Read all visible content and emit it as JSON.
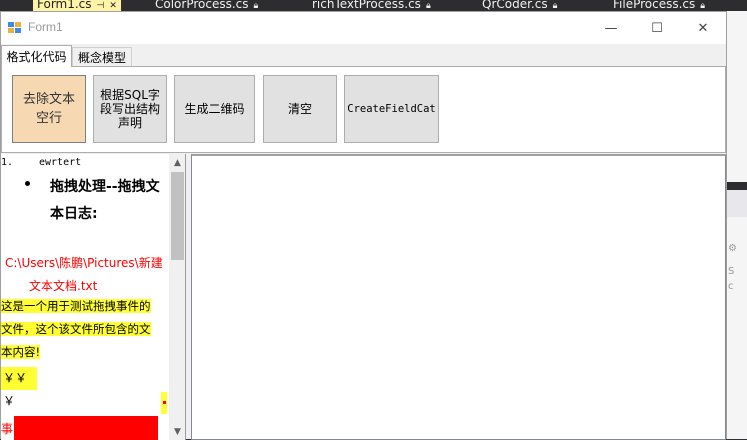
{
  "ide": {
    "tabs": [
      {
        "label": "Form1.cs",
        "active": true
      },
      {
        "label": "ColorProcess.cs",
        "active": false
      },
      {
        "label": "richTextProcess.cs",
        "active": false
      },
      {
        "label": "QrCoder.cs",
        "active": false
      },
      {
        "label": "FileProcess.cs",
        "active": false
      }
    ],
    "right_symbols": [
      "S",
      "c"
    ]
  },
  "window": {
    "title": "Form1",
    "icon": "winforms-app-icon",
    "controls": [
      "minimize-icon",
      "maximize-icon",
      "close-icon"
    ],
    "control_glyphs": [
      "—",
      "☐",
      "✕"
    ]
  },
  "tab_control": {
    "tabs": [
      {
        "label": "格式化代码",
        "active": true
      },
      {
        "label": "概念模型",
        "active": false
      }
    ]
  },
  "buttons": [
    {
      "label": "去除文本空行",
      "focused": true
    },
    {
      "label": "根据SQL字段写出结构声明",
      "focused": false
    },
    {
      "label": "生成二维码",
      "focused": false
    },
    {
      "label": "清空",
      "focused": false
    },
    {
      "label": "CreateFieldCat",
      "focused": false
    }
  ],
  "rich_text": {
    "line1_number": "1.",
    "line1_text": "ewrtert",
    "heading": "拖拽处理--拖拽文本日志:",
    "path_line1": "C:\\Users\\陈鹏\\Pictures\\新建",
    "path_line2": "文本文档.txt",
    "highlight_lines": [
      "这是一个用于测试拖拽事件的",
      "文件，这个该文件所包含的文",
      "本内容!"
    ],
    "yen": "￥￥￥",
    "red_char": "事"
  },
  "scrollbar": {
    "up": "▲",
    "down": "▼"
  },
  "colors": {
    "focused_button": "#f6d9b3",
    "highlight": "#ffff33",
    "red_text": "#ff0000",
    "active_vs_tab": "#fff3a8"
  }
}
